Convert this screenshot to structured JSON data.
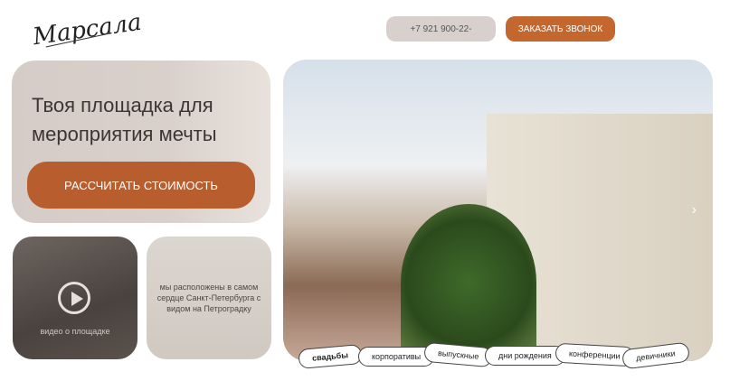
{
  "header": {
    "logo": "Марсала",
    "phone": "+7 921 900-22-",
    "call_button": "ЗАКАЗАТЬ ЗВОНОК"
  },
  "hero": {
    "title": "Твоя площадка для мероприятия мечты",
    "calc_button": "РАССЧИТАТЬ СТОИМОСТЬ"
  },
  "video": {
    "label": "видео о площадке"
  },
  "location": {
    "text": "мы расположены в самом сердце Санкт-Петербурга с видом на Петроградку"
  },
  "tags": [
    "свадьбы",
    "корпоративы",
    "выпускные",
    "дни рождения",
    "конференции",
    "девичники"
  ]
}
